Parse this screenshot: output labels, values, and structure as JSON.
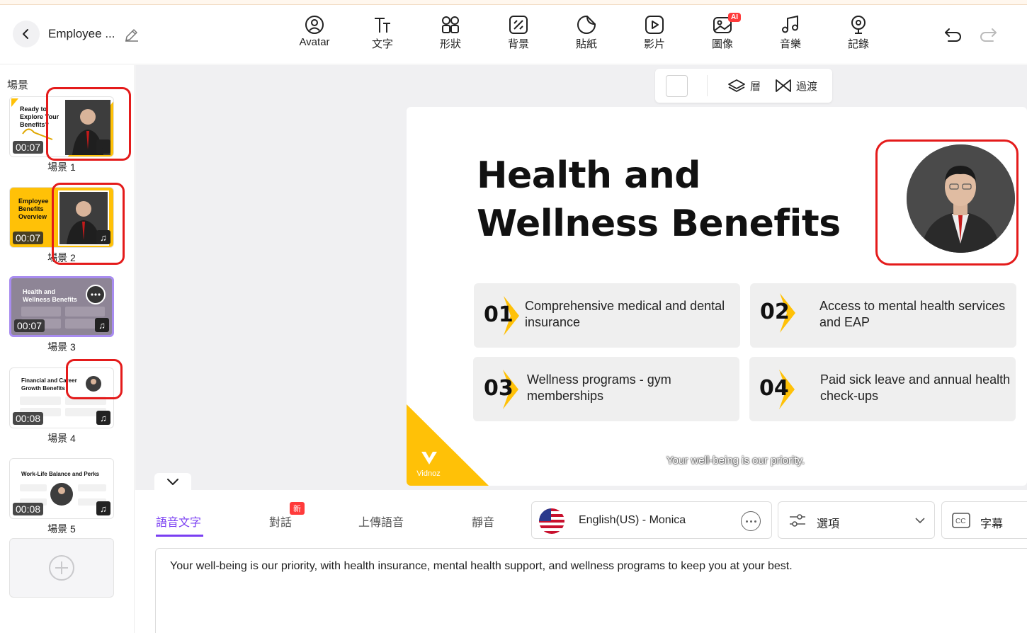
{
  "header": {
    "project_title": "Employee ...",
    "tools": [
      {
        "label": "Avatar",
        "icon": "avatar-icon"
      },
      {
        "label": "文字",
        "icon": "text-icon"
      },
      {
        "label": "形狀",
        "icon": "shapes-icon"
      },
      {
        "label": "背景",
        "icon": "background-icon"
      },
      {
        "label": "貼紙",
        "icon": "sticker-icon"
      },
      {
        "label": "影片",
        "icon": "video-icon"
      },
      {
        "label": "圖像",
        "icon": "image-icon",
        "badge": "AI"
      },
      {
        "label": "音樂",
        "icon": "music-icon"
      },
      {
        "label": "記錄",
        "icon": "record-icon"
      }
    ]
  },
  "sidebar": {
    "title": "場景",
    "scenes": [
      {
        "label": "場景 1",
        "time": "00:07",
        "title": "Ready to Explore Your Benefits?"
      },
      {
        "label": "場景 2",
        "time": "00:07",
        "title": "Employee Benefits Overview"
      },
      {
        "label": "場景 3",
        "time": "00:07",
        "title": "Health and Wellness Benefits"
      },
      {
        "label": "場景 4",
        "time": "00:08",
        "title": "Financial and Career Growth Benefits"
      },
      {
        "label": "場景 5",
        "time": "00:08",
        "title": "Work-Life Balance and Perks"
      }
    ]
  },
  "canvas_toolbar": {
    "layer_label": "層",
    "transition_label": "過渡"
  },
  "slide": {
    "title_line1": "Health and",
    "title_line2": "Wellness Benefits",
    "cards": [
      {
        "num": "01",
        "text": "Comprehensive medical and dental insurance"
      },
      {
        "num": "02",
        "text": "Access to mental health services and EAP"
      },
      {
        "num": "03",
        "text": "Wellness programs - gym memberships"
      },
      {
        "num": "04",
        "text": "Paid sick leave and annual health check-ups"
      }
    ],
    "brand": "Vidnoz",
    "caption": "Your well-being is our priority."
  },
  "bottom": {
    "tabs": [
      "語音文字",
      "對話",
      "上傳語音",
      "靜音"
    ],
    "new_badge": "新",
    "voice": "English(US) - Monica",
    "options_label": "選項",
    "subtitle_label": "字幕",
    "script": "Your well-being is our priority, with health insurance, mental health support, and wellness programs to keep you at your best."
  },
  "colors": {
    "accent": "#7a3ff2",
    "brand_yellow": "#ffc107",
    "highlight_red": "#e41b1b"
  }
}
